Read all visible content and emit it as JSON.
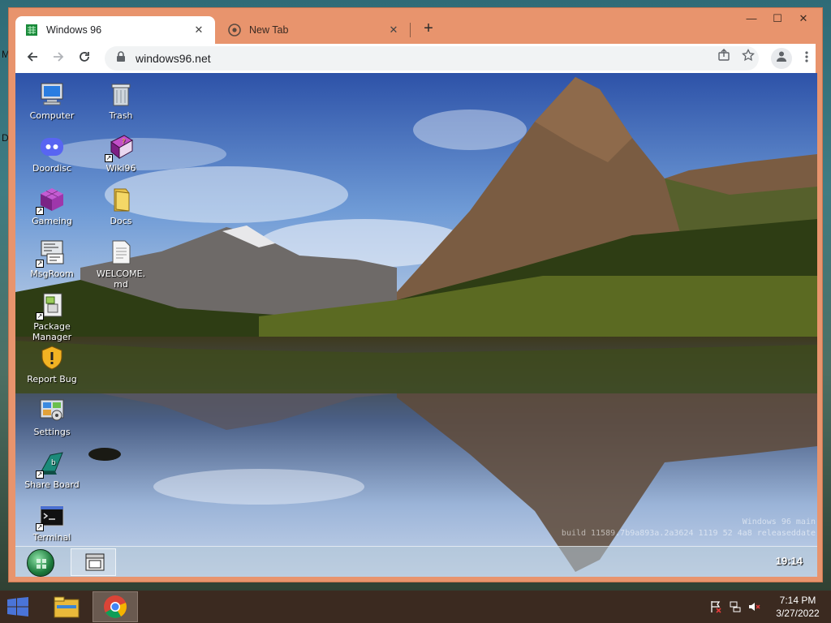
{
  "host": {
    "edge_text_top": "M",
    "edge_text_mid": "D",
    "taskbar": {
      "time": "7:14 PM",
      "date": "3/27/2022"
    }
  },
  "browser": {
    "tabs": [
      {
        "label": "Windows 96",
        "active": true
      },
      {
        "label": "New Tab",
        "active": false
      }
    ],
    "tab_close": "✕",
    "new_tab_symbol": "+",
    "window_controls": {
      "minimize": "—",
      "maximize": "☐",
      "close": "✕"
    },
    "url": "windows96.net"
  },
  "w96": {
    "icons": [
      {
        "label": "Computer",
        "icon": "computer-icon"
      },
      {
        "label": "Trash",
        "icon": "trash-icon"
      },
      {
        "label": "Doordisc",
        "icon": "discord-icon"
      },
      {
        "label": "Wiki96",
        "icon": "book-icon"
      },
      {
        "label": "Gameing",
        "icon": "game-cube-icon"
      },
      {
        "label": "Docs",
        "icon": "folder-icon"
      },
      {
        "label": "MsgRoom",
        "icon": "chat-icon"
      },
      {
        "label": "WELCOME.\nmd",
        "icon": "document-icon"
      },
      {
        "label": "Package\nManager",
        "icon": "package-icon"
      },
      {
        "label": "Report Bug",
        "icon": "warning-shield-icon"
      },
      {
        "label": "Settings",
        "icon": "settings-icon"
      },
      {
        "label": "Share Board",
        "icon": "share-board-icon"
      },
      {
        "label": "Terminal",
        "icon": "terminal-icon"
      }
    ],
    "watermark_line1": "Windows 96 main",
    "watermark_line2": "build 11589.7b9a893a.2a3624 1119 52 4a8 releaseddate",
    "clock": "19:14"
  }
}
